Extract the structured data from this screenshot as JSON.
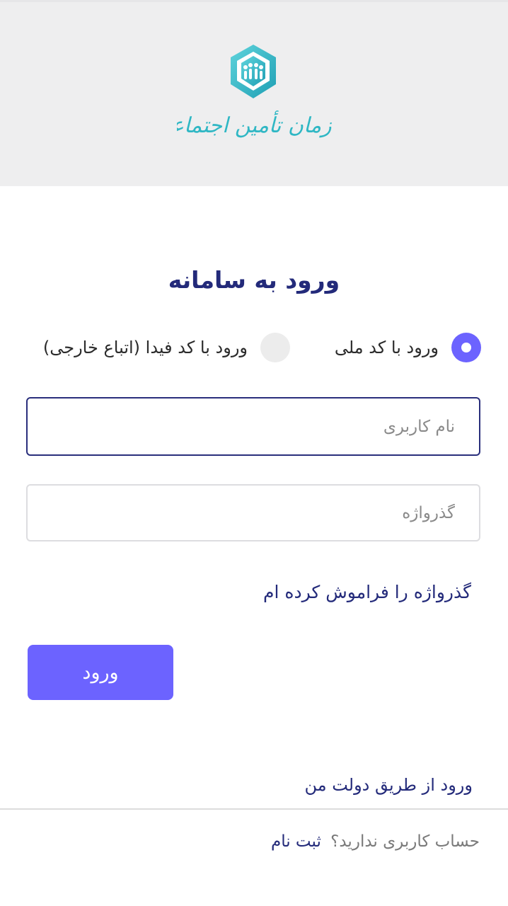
{
  "header": {
    "logo_text": "سازمان تأمین اجتماعی",
    "logo_color": "#2fb7c4"
  },
  "login": {
    "title": "ورود به سامانه",
    "options": [
      {
        "label": "ورود با کد ملی",
        "selected": true
      },
      {
        "label": "ورود با کد فیدا (اتباع خارجی)",
        "selected": false
      }
    ],
    "username_placeholder": "نام کاربری",
    "password_placeholder": "گذرواژه",
    "forgot_label": "گذرواژه را فراموش کرده ام",
    "submit_label": "ورود",
    "gov_login_label": "ورود از طریق دولت من"
  },
  "footer": {
    "no_account_text": "حساب کاربری ندارید؟",
    "signup_label": "ثبت نام"
  },
  "colors": {
    "accent": "#6c63ff",
    "title": "#232a7a",
    "header_bg": "#eeeeef"
  }
}
